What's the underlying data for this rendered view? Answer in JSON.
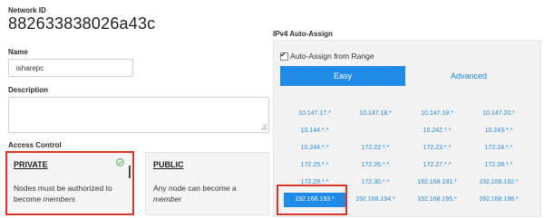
{
  "network": {
    "id_label": "Network ID",
    "id_value": "882633838026a43c"
  },
  "name": {
    "label": "Name",
    "value": "isharepc"
  },
  "description": {
    "label": "Description",
    "value": ""
  },
  "access_control": {
    "label": "Access Control",
    "private": {
      "title": "PRIVATE",
      "desc_prefix": "Nodes must be authorized to become ",
      "desc_em": "members",
      "selected": true
    },
    "public": {
      "title": "PUBLIC",
      "desc_prefix": "Any node can become a ",
      "desc_em": "member"
    }
  },
  "ipv4": {
    "label": "IPv4 Auto-Assign",
    "auto_assign_label": "Auto-Assign from Range",
    "auto_assign_checked": true,
    "tabs": {
      "easy": "Easy",
      "advanced": "Advanced"
    },
    "active_tab": "Easy",
    "ranges": [
      [
        "10.147.17.*",
        "10.147.18.*",
        "10.147.19.*",
        "10.147.20.*"
      ],
      [
        "10.144.*.*",
        "",
        "10.242.*.*",
        "10.243.*.*"
      ],
      [
        "10.244.*.*",
        "172.22.*.*",
        "172.23.*.*",
        "172.24.*.*"
      ],
      [
        "172.25.*.*",
        "172.26.*.*",
        "172.27.*.*",
        "172.28.*.*"
      ],
      [
        "172.29.*.*",
        "172.30.*.*",
        "192.168.191.*",
        "192.168.192.*"
      ],
      [
        "192.168.193.*",
        "192.168.194.*",
        "192.168.195.*",
        "192.168.196.*"
      ]
    ],
    "selected_range": "192.168.193.*"
  },
  "colors": {
    "accent": "#1f8be6",
    "highlight_outline": "#d9352a",
    "link": "#2d86d9",
    "check_green": "#3aa34a"
  },
  "icons": {
    "private_selected": "check-circle-icon",
    "auto_assign": "checkbox-icon"
  }
}
